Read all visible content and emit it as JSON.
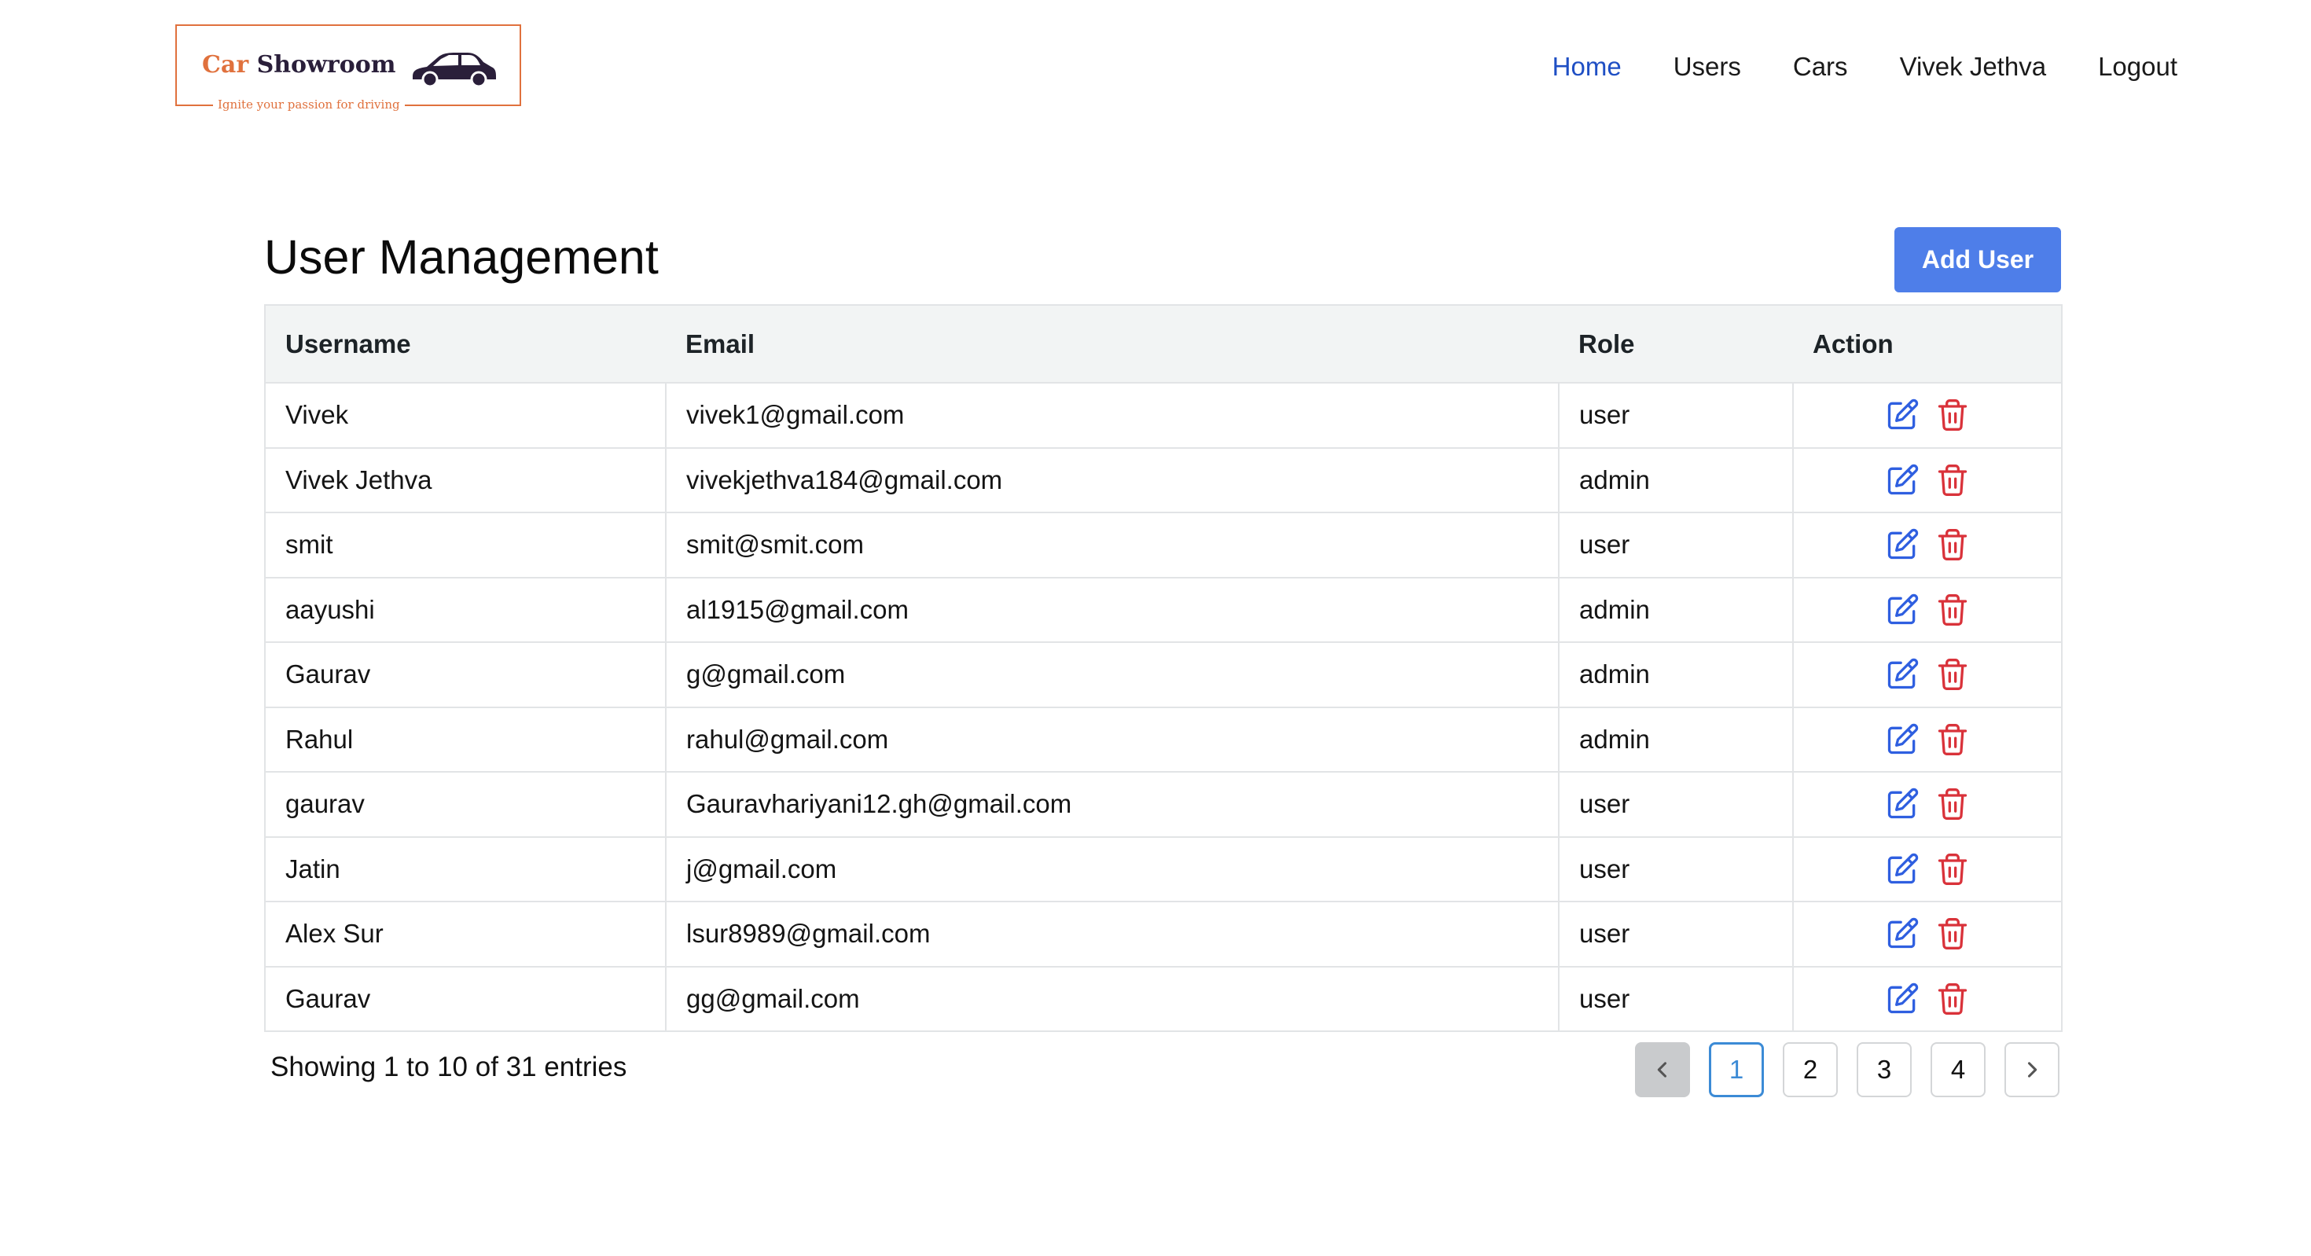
{
  "brand": {
    "name_part1": "Car",
    "name_part2": "Showroom",
    "tagline": "Ignite your passion for driving",
    "accent_color": "#e0713d",
    "car_icon": "car-icon"
  },
  "nav": {
    "items": [
      {
        "label": "Home",
        "active": true
      },
      {
        "label": "Users",
        "active": false
      },
      {
        "label": "Cars",
        "active": false
      },
      {
        "label": "Vivek Jethva",
        "active": false
      },
      {
        "label": "Logout",
        "active": false
      }
    ]
  },
  "page": {
    "title": "User Management",
    "add_button_label": "Add User",
    "primary_color": "#4e7ee9"
  },
  "table": {
    "columns": [
      "Username",
      "Email",
      "Role",
      "Action"
    ],
    "rows": [
      {
        "username": "Vivek",
        "email": "vivek1@gmail.com",
        "role": "user"
      },
      {
        "username": "Vivek Jethva",
        "email": "vivekjethva184@gmail.com",
        "role": "admin"
      },
      {
        "username": "smit",
        "email": "smit@smit.com",
        "role": "user"
      },
      {
        "username": "aayushi",
        "email": "al1915@gmail.com",
        "role": "admin"
      },
      {
        "username": "Gaurav",
        "email": "g@gmail.com",
        "role": "admin"
      },
      {
        "username": "Rahul",
        "email": "rahul@gmail.com",
        "role": "admin"
      },
      {
        "username": "gaurav",
        "email": "Gauravhariyani12.gh@gmail.com",
        "role": "user"
      },
      {
        "username": "Jatin",
        "email": "j@gmail.com",
        "role": "user"
      },
      {
        "username": "Alex Sur",
        "email": "lsur8989@gmail.com",
        "role": "user"
      },
      {
        "username": "Gaurav",
        "email": "gg@gmail.com",
        "role": "user"
      }
    ],
    "edit_icon": "edit-icon",
    "delete_icon": "trash-icon",
    "edit_color": "#2f5fe0",
    "delete_color": "#d9323a"
  },
  "pagination": {
    "summary": "Showing 1 to 10 of 31 entries",
    "pages": [
      "1",
      "2",
      "3",
      "4"
    ],
    "current": "1",
    "prev_icon": "chevron-left-icon",
    "next_icon": "chevron-right-icon"
  }
}
